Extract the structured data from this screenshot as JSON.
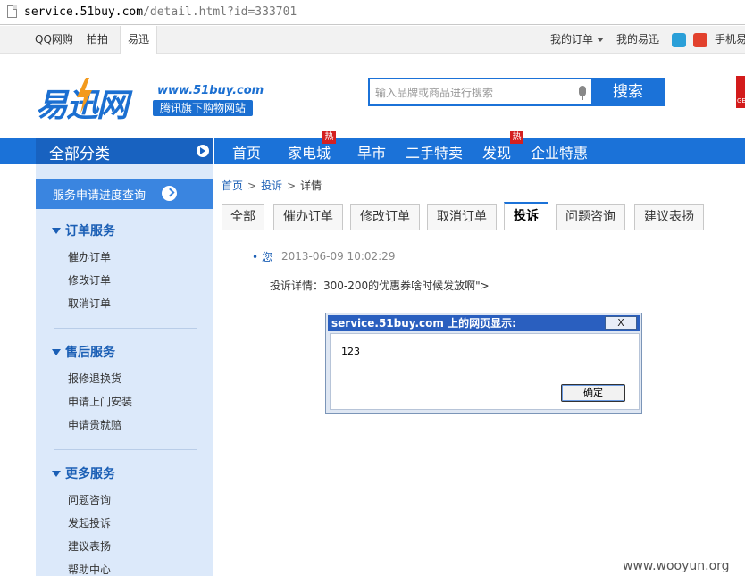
{
  "browser": {
    "url_host": "service.51buy.com",
    "url_path": "/detail.html?id=333701"
  },
  "topbar": {
    "sites": [
      "QQ网购",
      "拍拍",
      "易迅"
    ],
    "active_site": "易迅",
    "my_orders": "我的订单",
    "my_yixun": "我的易迅",
    "mobile": "手机易"
  },
  "header": {
    "logo_text": "易迅网",
    "logo_url": "www.51buy.com",
    "logo_tagline": "腾讯旗下购物网站",
    "search_placeholder": "输入品牌或商品进行搜索",
    "search_button": "搜索",
    "edge_badge": "GE"
  },
  "nav": {
    "category_label": "全部分类",
    "items": [
      "首页",
      "家电城",
      "早市",
      "二手特卖",
      "发现",
      "企业特惠"
    ],
    "hot_label": "热"
  },
  "sidebar": {
    "progress_button": "服务申请进度查询",
    "sections": [
      {
        "title": "订单服务",
        "links": [
          "催办订单",
          "修改订单",
          "取消订单"
        ]
      },
      {
        "title": "售后服务",
        "links": [
          "报修退换货",
          "申请上门安装",
          "申请贵就赔"
        ]
      },
      {
        "title": "更多服务",
        "links": [
          "问题咨询",
          "发起投诉",
          "建议表扬",
          "帮助中心"
        ]
      }
    ]
  },
  "main": {
    "breadcrumb": [
      "首页",
      "投诉",
      "详情"
    ],
    "breadcrumb_sep": ">",
    "tabs": [
      "全部",
      "催办订单",
      "修改订单",
      "取消订单",
      "投诉",
      "问题咨询",
      "建议表扬"
    ],
    "active_tab": "投诉",
    "entry": {
      "user": "• 您",
      "time": "2013-06-09 10:02:29",
      "body": "投诉详情：300-200的优惠券啥时候发放啊\">"
    }
  },
  "dialog": {
    "title": "service.51buy.com 上的网页显示:",
    "close_label": "X",
    "message": "123",
    "ok_label": "确定"
  },
  "watermark": "www.wooyun.org",
  "colors": {
    "brand_blue": "#1b72d8",
    "sidebar_bg": "#dce9fa",
    "hot_red": "#d42020"
  }
}
